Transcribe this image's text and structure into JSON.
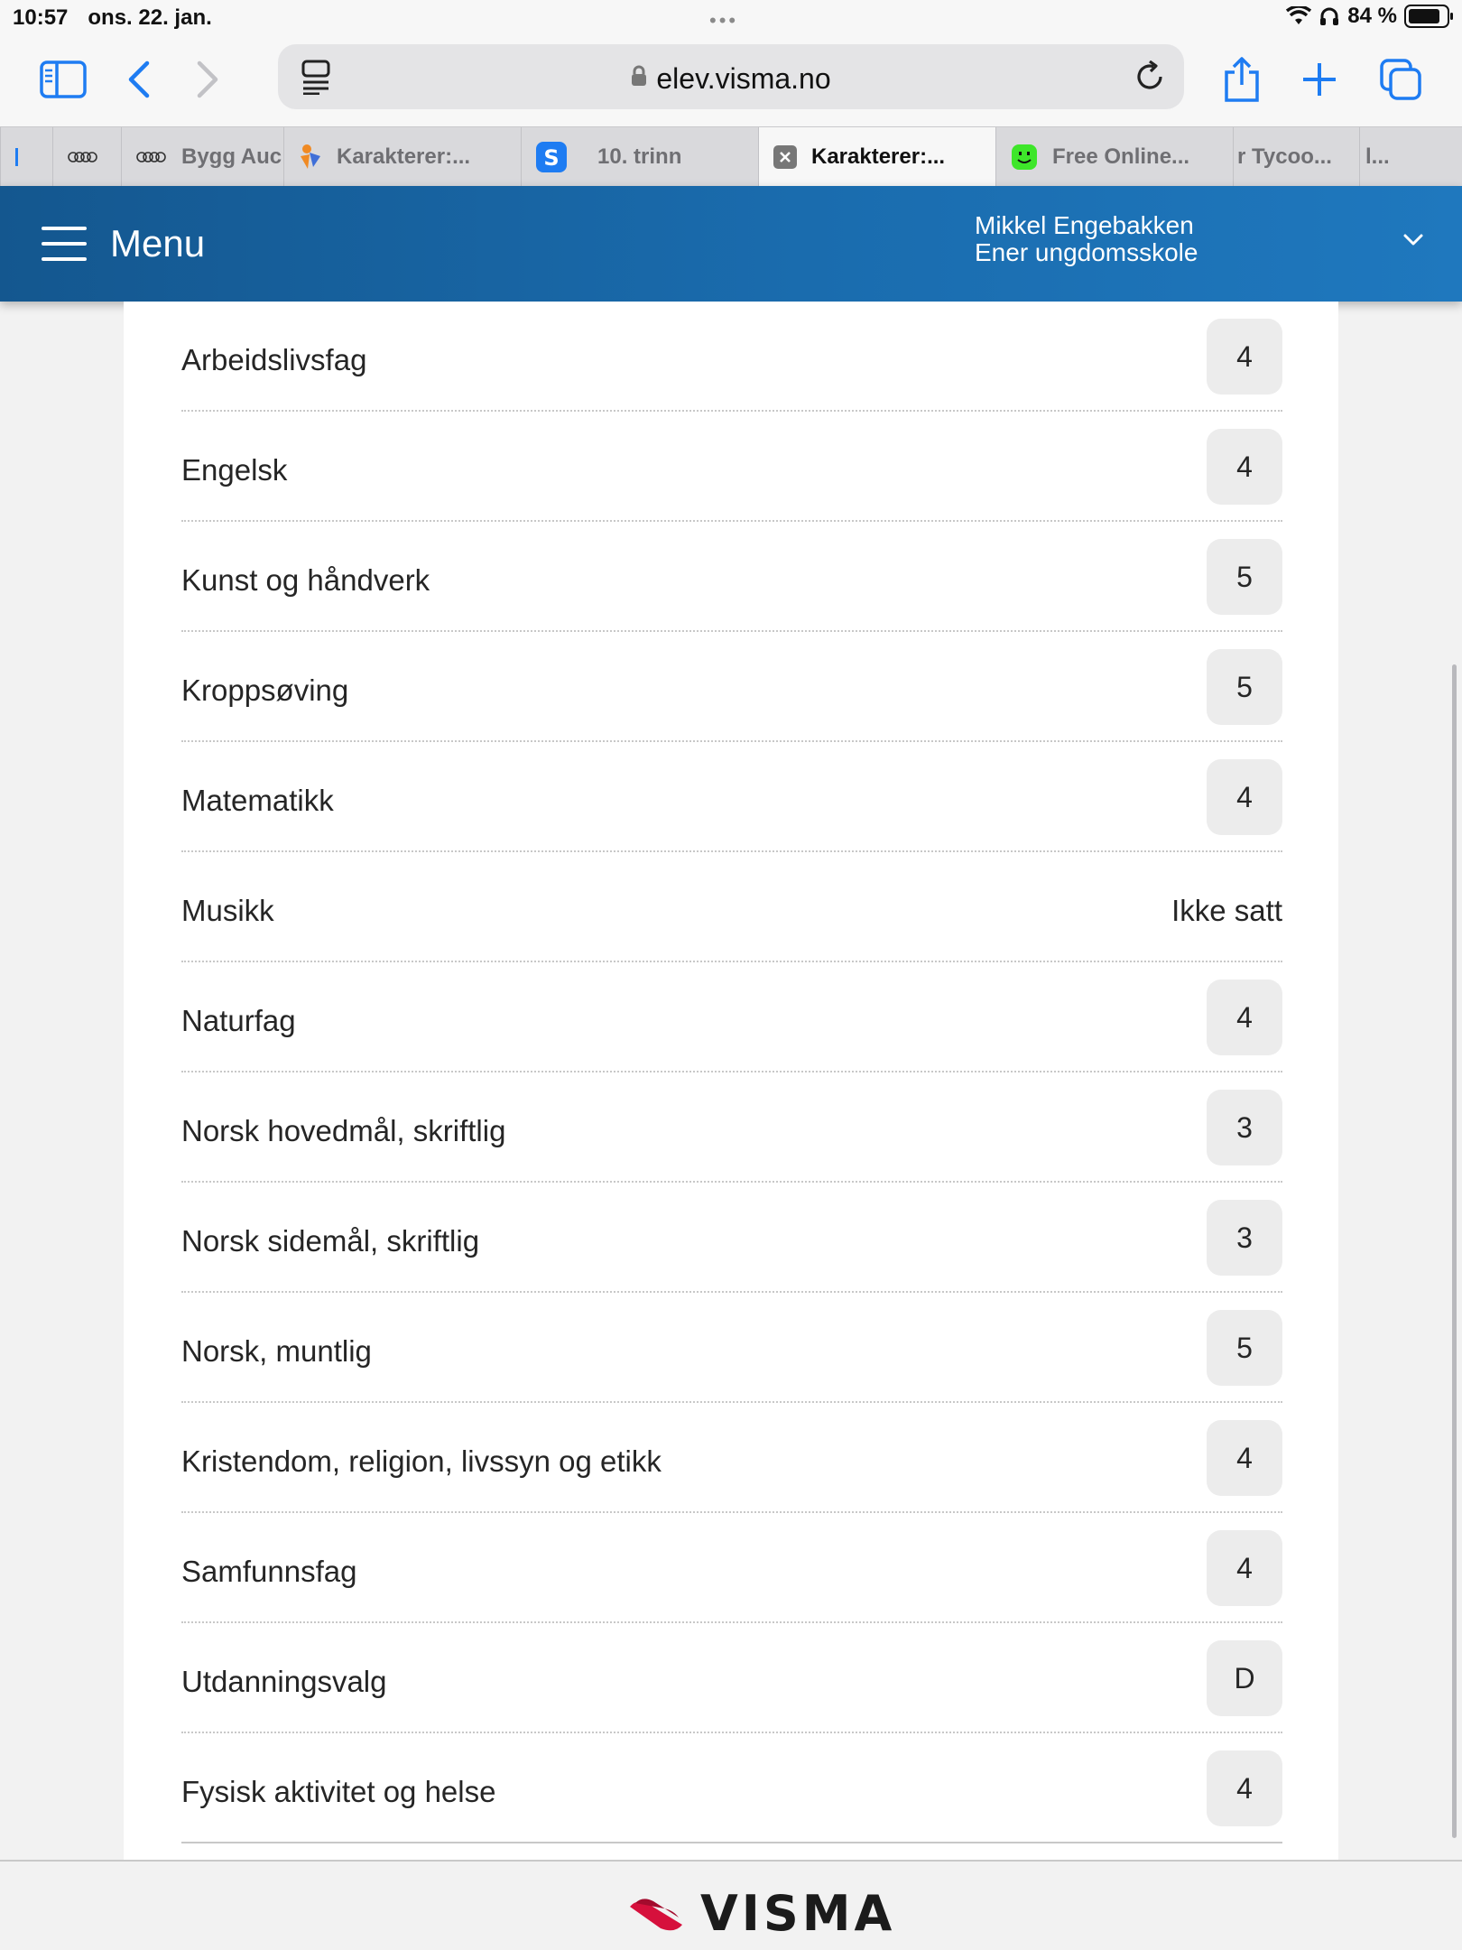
{
  "status_bar": {
    "time": "10:57",
    "date": "ons. 22. jan.",
    "battery_text": "84 %",
    "battery_level": 0.84
  },
  "browser": {
    "url": "elev.visma.no",
    "tabs": [
      {
        "title": "",
        "icon": "blank-icon"
      },
      {
        "title": "",
        "icon": "audi-rings-icon"
      },
      {
        "title": "Bygg Auc",
        "icon": "audi-rings-icon"
      },
      {
        "title": "Karakterer:...",
        "icon": "orange-figure-icon"
      },
      {
        "title": "10. trinn",
        "icon": "s-logo-icon"
      },
      {
        "title": "Karakterer:...",
        "icon": "close-icon",
        "active": true
      },
      {
        "title": "Free Online...",
        "icon": "green-face-icon"
      },
      {
        "title": "r Tycoo...",
        "icon": ""
      },
      {
        "title": "l...",
        "icon": ""
      }
    ]
  },
  "header": {
    "menu_label": "Menu",
    "user_name": "Mikkel Engebakken",
    "school": "Ener ungdomsskole"
  },
  "grades": [
    {
      "subject": "Arbeidslivsfag",
      "grade": "4"
    },
    {
      "subject": "Engelsk",
      "grade": "4"
    },
    {
      "subject": "Kunst og håndverk",
      "grade": "5"
    },
    {
      "subject": "Kroppsøving",
      "grade": "5"
    },
    {
      "subject": "Matematikk",
      "grade": "4"
    },
    {
      "subject": "Musikk",
      "grade": "Ikke satt",
      "not_set": true
    },
    {
      "subject": "Naturfag",
      "grade": "4"
    },
    {
      "subject": "Norsk hovedmål, skriftlig",
      "grade": "3"
    },
    {
      "subject": "Norsk sidemål, skriftlig",
      "grade": "3"
    },
    {
      "subject": "Norsk, muntlig",
      "grade": "5"
    },
    {
      "subject": "Kristendom, religion, livssyn og etikk",
      "grade": "4"
    },
    {
      "subject": "Samfunnsfag",
      "grade": "4"
    },
    {
      "subject": "Utdanningsvalg",
      "grade": "D"
    },
    {
      "subject": "Fysisk aktivitet og helse",
      "grade": "4"
    }
  ],
  "footer": {
    "brand": "VISMA"
  },
  "colors": {
    "accent": "#1a6cae",
    "ios_blue": "#1e7cf2",
    "visma_red": "#d6103c"
  }
}
